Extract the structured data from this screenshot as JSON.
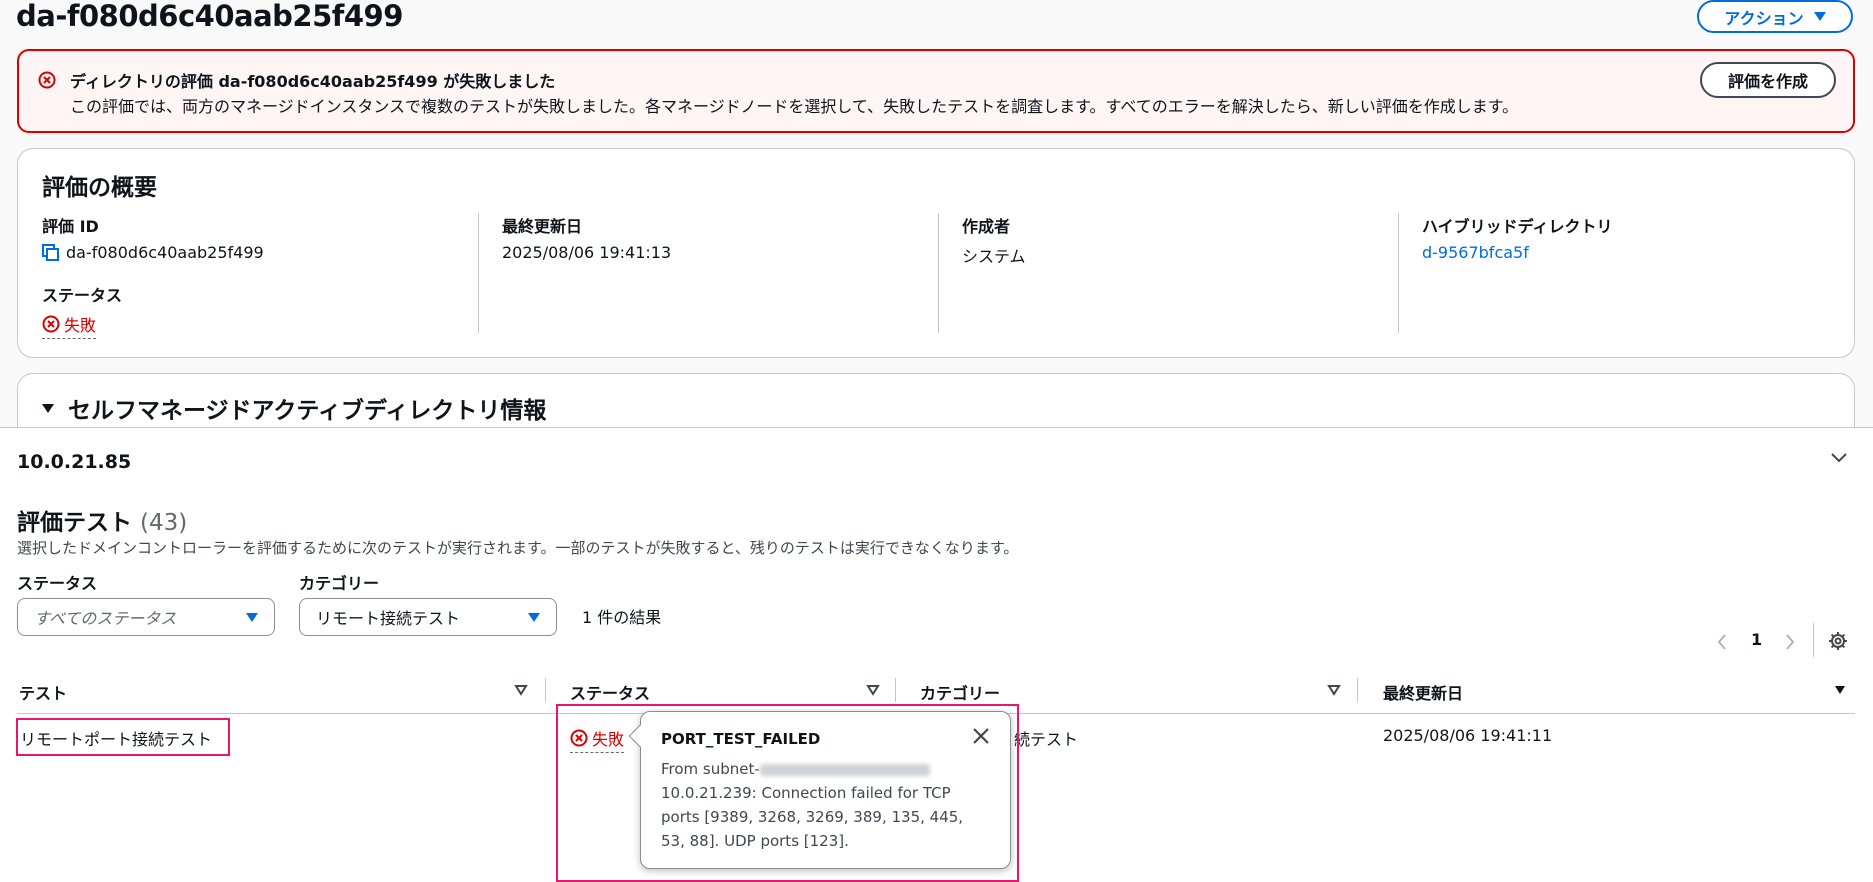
{
  "header": {
    "title": "da-f080d6c40aab25f499",
    "actions_label": "アクション"
  },
  "alert": {
    "title": "ディレクトリの評価 da-f080d6c40aab25f499 が失敗しました",
    "text": "この評価では、両方のマネージドインスタンスで複数のテストが失敗しました。各マネージドノードを選択して、失敗したテストを調査します。すべてのエラーを解決したら、新しい評価を作成します。",
    "button_label": "評価を作成"
  },
  "summary": {
    "title": "評価の概要",
    "assessment_id_label": "評価 ID",
    "assessment_id": "da-f080d6c40aab25f499",
    "status_label": "ステータス",
    "status_value": "失敗",
    "last_updated_label": "最終更新日",
    "last_updated": "2025/08/06 19:41:13",
    "creator_label": "作成者",
    "creator": "システム",
    "hybrid_dir_label": "ハイブリッドディレクトリ",
    "hybrid_dir": "d-9567bfca5f"
  },
  "self_managed": {
    "title": "セルフマネージドアクティブディレクトリ情報"
  },
  "node": {
    "ip": "10.0.21.85"
  },
  "tests": {
    "title": "評価テスト",
    "count": "(43)",
    "description": "選択したドメインコントローラーを評価するために次のテストが実行されます。一部のテストが失敗すると、残りのテストは実行できなくなります。",
    "filter_status_label": "ステータス",
    "filter_status_placeholder": "すべてのステータス",
    "filter_category_label": "カテゴリー",
    "filter_category_value": "リモート接続テスト",
    "results_text": "1 件の結果",
    "page": "1",
    "columns": [
      "テスト",
      "ステータス",
      "カテゴリー",
      "最終更新日"
    ],
    "rows": [
      {
        "test": "リモートポート接続テスト",
        "status": "失敗",
        "category_visible": "続テスト",
        "last_updated": "2025/08/06 19:41:11"
      }
    ]
  },
  "popover": {
    "title": "PORT_TEST_FAILED",
    "line1": "From subnet-",
    "body": "10.0.21.239: Connection failed for TCP ports [9389, 3268, 3269, 389, 135, 445, 53, 88]. UDP ports [123]."
  },
  "colors": {
    "accent": "#006ce0",
    "error": "#db0000",
    "highlight": "#e8166d",
    "alert_bg": "#fff5f5"
  }
}
